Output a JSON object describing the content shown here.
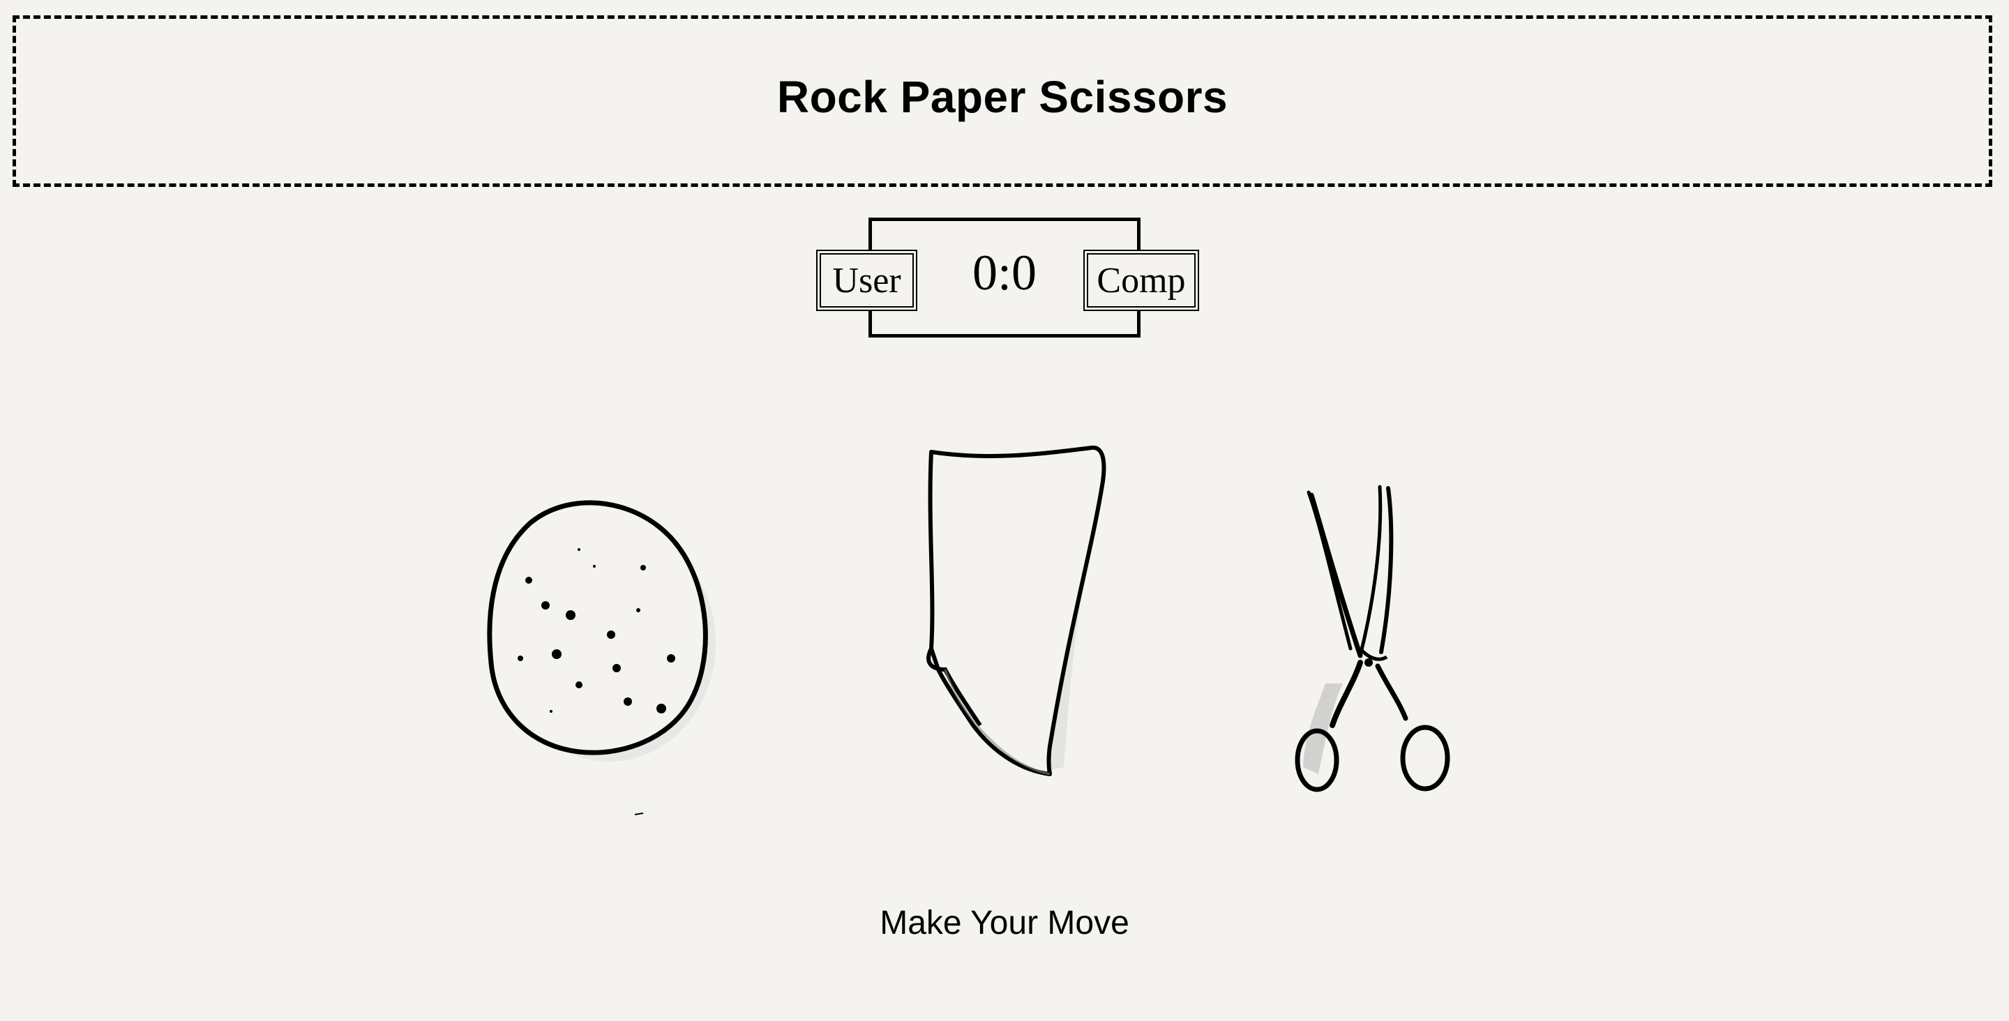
{
  "header": {
    "title": "Rock Paper Scissors"
  },
  "scoreboard": {
    "user_label": "User",
    "comp_label": "Comp",
    "score": "0:0"
  },
  "choices": [
    {
      "id": "rock",
      "icon": "rock-icon"
    },
    {
      "id": "paper",
      "icon": "paper-icon"
    },
    {
      "id": "scissors",
      "icon": "scissors-icon"
    }
  ],
  "prompt": "Make Your Move"
}
